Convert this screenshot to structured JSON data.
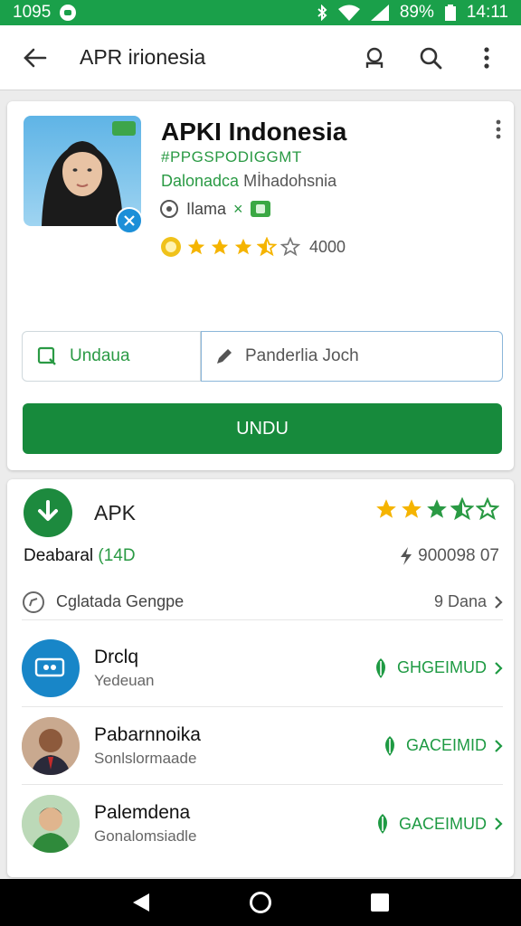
{
  "status_bar": {
    "time": "1095",
    "battery": "89%",
    "clock": "14:11"
  },
  "toolbar": {
    "title": "APR irionesia"
  },
  "app": {
    "name": "APKI Indonesia",
    "developer": "#PPGSPODIGGMT",
    "subtitle_green": "Dalonadca",
    "subtitle_rest": " Mİhadohsnia",
    "meta_label": "Ilama",
    "meta_mark": "×",
    "rating_value": "4000"
  },
  "actions": {
    "outline_button": "Undaua",
    "search_placeholder": "Panderlia Joch",
    "primary_button": "UNDU"
  },
  "apk": {
    "title": "APK",
    "developer_prefix": "Deabaral",
    "developer_suffix": "(14D",
    "size": "900098 07",
    "category": "Cglatada Gengpe",
    "category_link": "9 Dana"
  },
  "list": [
    {
      "title": "Drclq",
      "subtitle": "Yedeuan",
      "action": "GHGEIMUD"
    },
    {
      "title": "Pabarnnoika",
      "subtitle": "Sonlslormaade",
      "action": "GACEIMID"
    },
    {
      "title": "Palemdena",
      "subtitle": "Gonalomsiadle",
      "action": "GACEIMUD"
    }
  ],
  "colors": {
    "primary": "#178a3c",
    "status_bar": "#1aa04a",
    "accent": "#2a9a44",
    "star": "#f5b400"
  }
}
